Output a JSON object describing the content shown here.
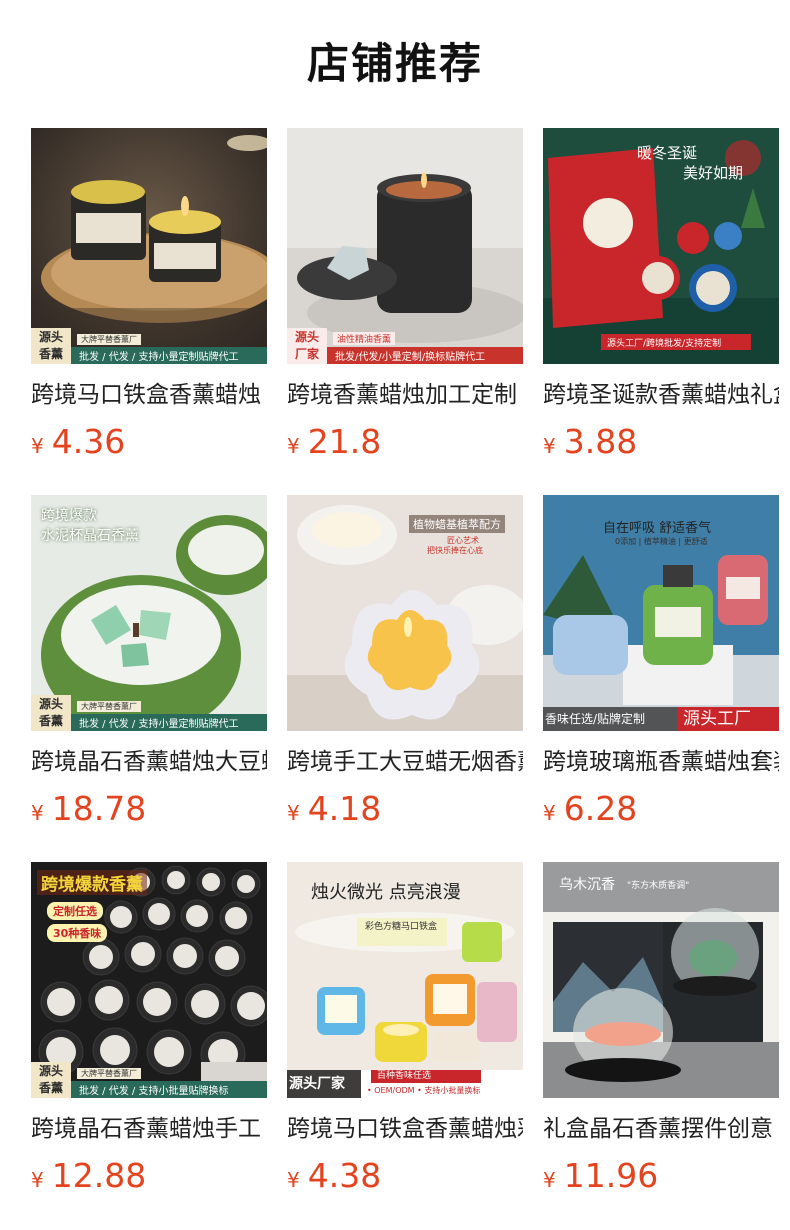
{
  "header": {
    "title": "店铺推荐"
  },
  "currency_symbol": "¥",
  "products": [
    {
      "name": "跨境马口铁盒香薰蜡烛",
      "price": "4.36",
      "image": {
        "badge": [
          "源头",
          "香薰"
        ],
        "tag": "大牌平替香薰厂",
        "banner": "批发 / 代发 / 支持小量定制贴牌代工"
      }
    },
    {
      "name": "跨境香薰蜡烛加工定制",
      "price": "21.8",
      "image": {
        "badge": [
          "源头",
          "厂家"
        ],
        "tag": "油性精油香薰",
        "banner": "批发/代发/小量定制/换标贴牌代工"
      }
    },
    {
      "name": "跨境圣诞款香薰蜡烛礼盒",
      "price": "3.88",
      "image": {
        "headline": "暖冬圣诞",
        "headline2": "美好如期",
        "banner": "源头工厂/跨境批发/支持定制"
      }
    },
    {
      "name": "跨境晶石香薰蜡烛大豆蜡",
      "price": "18.78",
      "image": {
        "headline": "跨境爆款",
        "headline2": "水泥杯晶石香薰",
        "badge": [
          "源头",
          "香薰"
        ],
        "tag": "大牌平替香薰厂",
        "banner": "批发 / 代发 / 支持小量定制贴牌代工"
      }
    },
    {
      "name": "跨境手工大豆蜡无烟香薰",
      "price": "4.18",
      "image": {
        "headline": "植物蜡基植萃配方",
        "headline2": "匠心艺术",
        "headline3": "把快乐捧在心底"
      }
    },
    {
      "name": "跨境玻璃瓶香薰蜡烛套装",
      "price": "6.28",
      "image": {
        "headline": "自在呼吸 舒适香气",
        "headline2": "0添加 | 植萃精油 | 更舒适",
        "banner_left": "香味任选/贴牌定制",
        "banner_right": "源头工厂"
      }
    },
    {
      "name": "跨境晶石香薰蜡烛手工",
      "price": "12.88",
      "image": {
        "headline": "跨境爆款香薰",
        "pill1": "定制任选",
        "pill2": "30种香味",
        "badge": [
          "源头",
          "香薰"
        ],
        "tag": "大牌平替香薰厂",
        "banner": "批发 / 代发 / 支持小批量贴牌换标"
      }
    },
    {
      "name": "跨境马口铁盒香薰蜡烛彩色",
      "price": "4.38",
      "image": {
        "headline": "烛火微光 点亮浪漫",
        "label": "彩色方糖马口铁盒",
        "banner_left": "源头厂家",
        "banner_tag": "百种香味任选",
        "banner_sub": "• OEM/ODM • 支持小批量换标"
      }
    },
    {
      "name": "礼盒晶石香薰摆件创意",
      "price": "11.96",
      "image": {
        "headline": "乌木沉香",
        "headline2": "\"东方木质香调\""
      }
    }
  ],
  "colors": {
    "price": "#e4431f",
    "title": "#111111",
    "name": "#222222"
  }
}
